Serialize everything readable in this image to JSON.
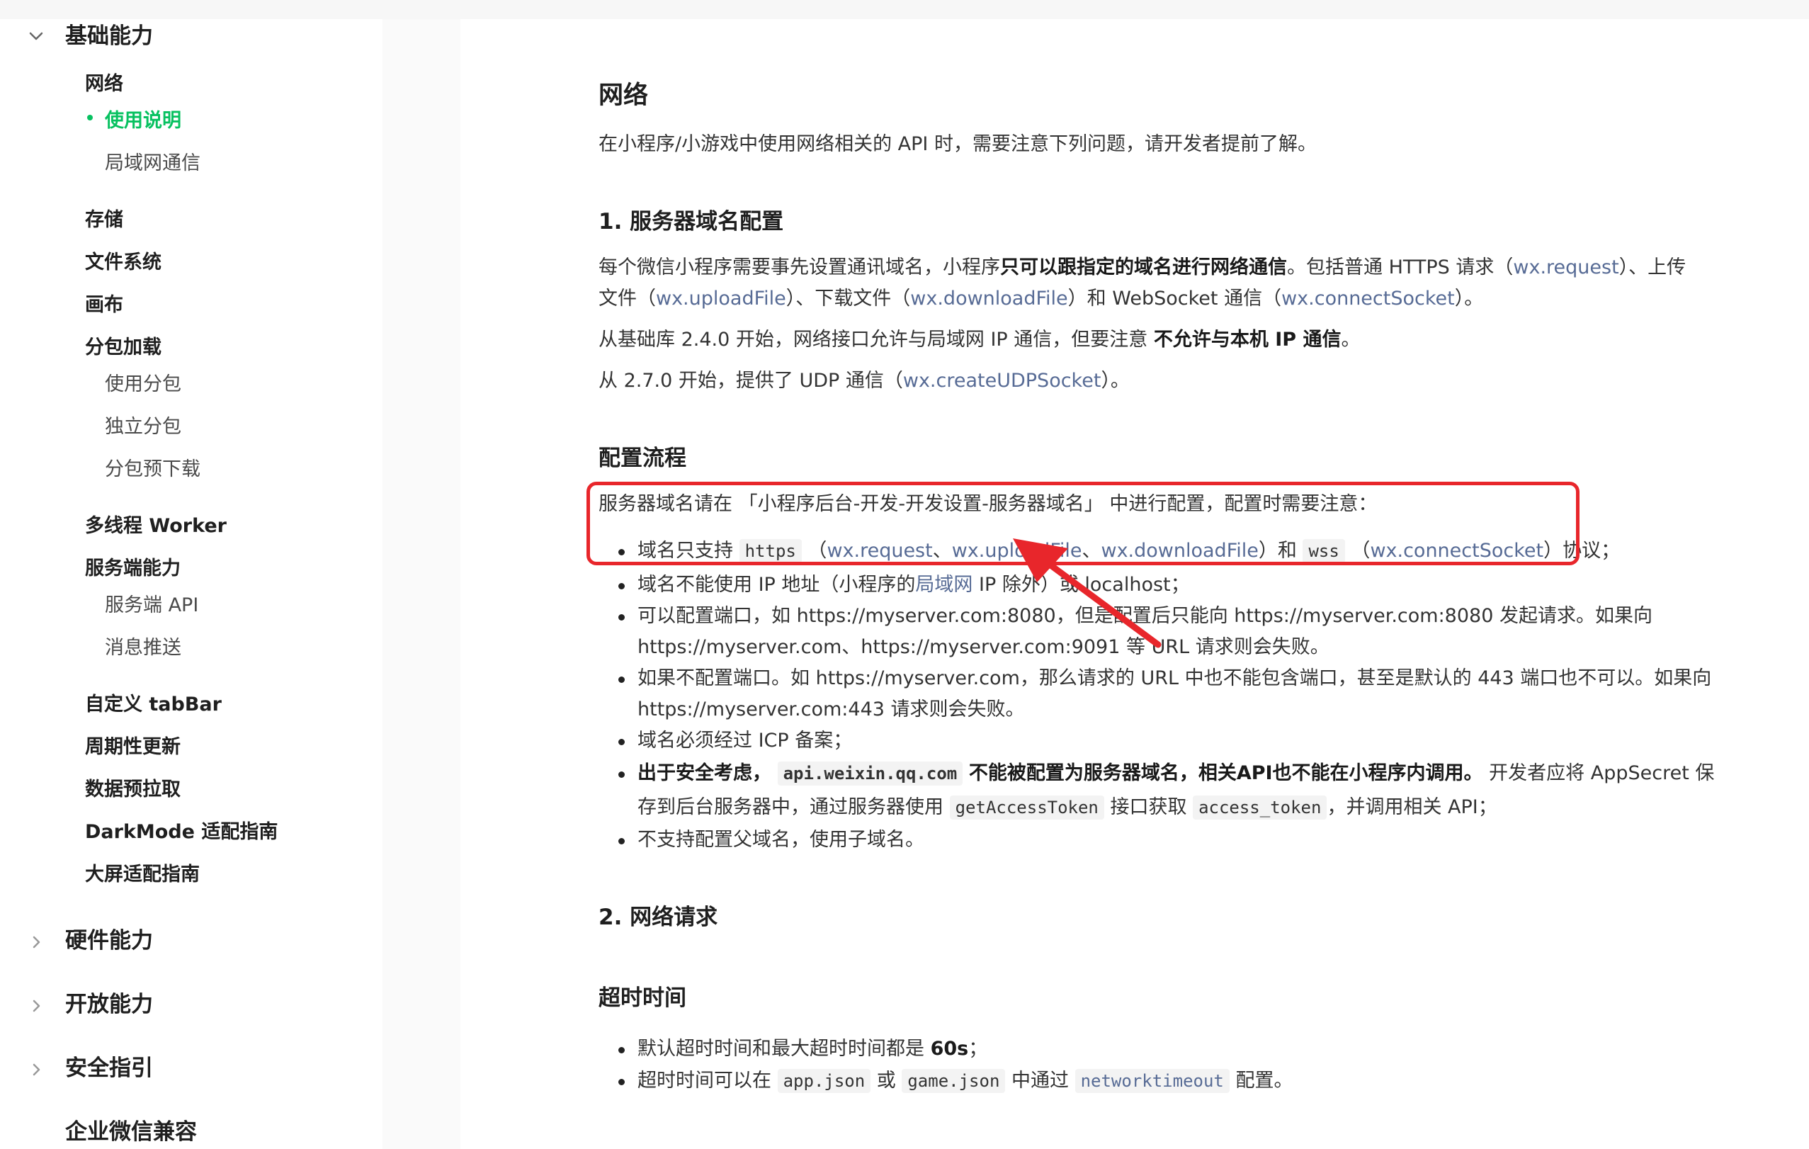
{
  "sidebar": {
    "section_basic": "基础能力",
    "network": "网络",
    "usage": "使用说明",
    "lan": "局域网通信",
    "storage": "存储",
    "filesystem": "文件系统",
    "canvas": "画布",
    "subpackage": "分包加载",
    "use_subpackage": "使用分包",
    "independent_subpackage": "独立分包",
    "preload_subpackage": "分包预下载",
    "worker": "多线程 Worker",
    "server": "服务端能力",
    "server_api": "服务端 API",
    "push": "消息推送",
    "tabbar": "自定义 tabBar",
    "periodic": "周期性更新",
    "prefetch": "数据预拉取",
    "darkmode": "DarkMode 适配指南",
    "largescreen": "大屏适配指南",
    "section_hardware": "硬件能力",
    "section_open": "开放能力",
    "section_security": "安全指引",
    "section_wecom": "企业微信兼容"
  },
  "content": {
    "title": "网络",
    "intro": "在小程序/小游戏中使用网络相关的 API 时，需要注意下列问题，请开发者提前了解。",
    "h_domain": "1. 服务器域名配置",
    "p1_a": "每个微信小程序需要事先设置通讯域名，小程序",
    "p1_bold": "只可以跟指定的域名进行网络通信",
    "p1_b": "。包括普通 HTTPS 请求（",
    "p1_l1": "wx.request",
    "p1_c": "）、上传",
    "p2_a": "文件（",
    "p2_l1": "wx.uploadFile",
    "p2_b": "）、下载文件（",
    "p2_l2": "wx.downloadFile",
    "p2_c": "）和 WebSocket 通信（",
    "p2_l3": "wx.connectSocket",
    "p2_d": "）。",
    "p3_a": "从基础库 2.4.0 开始，网络接口允许与局域网 IP 通信，但要注意 ",
    "p3_bold": "不允许与本机 IP 通信",
    "p3_b": "。",
    "p4_a": "从 2.7.0 开始，提供了 UDP 通信（",
    "p4_link": "wx.createUDPSocket",
    "p4_b": "）。",
    "h_flow": "配置流程",
    "flow_intro": "服务器域名请在 「小程序后台-开发-开发设置-服务器域名」 中进行配置，配置时需要注意：",
    "b1_a": "域名只支持 ",
    "b1_code1": "https",
    "b1_b": " （",
    "b1_l1": "wx.request",
    "b1_s1": "、",
    "b1_l2": "wx.uploadFile",
    "b1_s2": "、",
    "b1_l3": "wx.downloadFile",
    "b1_c": "）和 ",
    "b1_code2": "wss",
    "b1_d": " （",
    "b1_l4": "wx.connectSocket",
    "b1_e": "）协议；",
    "b2_a": "域名不能使用 IP 地址（小程序的",
    "b2_link": "局域网",
    "b2_b": " IP 除外）或 localhost；",
    "b3_l1": "可以配置端口，如 https://myserver.com:8080，但是配置后只能向 https://myserver.com:8080 发起请求。如果向",
    "b3_l2": "https://myserver.com、https://myserver.com:9091 等 URL 请求则会失败。",
    "b4_l1": "如果不配置端口。如 https://myserver.com，那么请求的 URL 中也不能包含端口，甚至是默认的 443 端口也不可以。如果向",
    "b4_l2": "https://myserver.com:443 请求则会失败。",
    "b5": "域名必须经过 ICP 备案；",
    "b6_bold1": "出于安全考虑，",
    "b6_code": "api.weixin.qq.com",
    "b6_bold2": "不能被配置为服务器域名，相关API也不能在小程序内调用。",
    "b6_a": " 开发者应将 AppSecret 保",
    "b6_l2_a": "存到后台服务器中，通过服务器使用 ",
    "b6_l2_code1": "getAccessToken",
    "b6_l2_b": " 接口获取 ",
    "b6_l2_code2": "access_token",
    "b6_l2_c": "，并调用相关 API；",
    "b7": "不支持配置父域名，使用子域名。",
    "h_request": "2. 网络请求",
    "h_timeout": "超时时间",
    "t1_a": "默认超时时间和最大超时时间都是 ",
    "t1_bold": "60s",
    "t1_b": "；",
    "t2_a": "超时时间可以在 ",
    "t2_code1": "app.json",
    "t2_b": " 或 ",
    "t2_code2": "game.json",
    "t2_c": " 中通过 ",
    "t2_code3": "networktimeout",
    "t2_d": " 配置。"
  },
  "colors": {
    "accent_green": "#07c160",
    "link_blue": "#576b95",
    "annotation_red": "#e8262b"
  },
  "icons": {
    "expanded": "chevron-down-icon",
    "collapsed": "chevron-right-icon"
  }
}
